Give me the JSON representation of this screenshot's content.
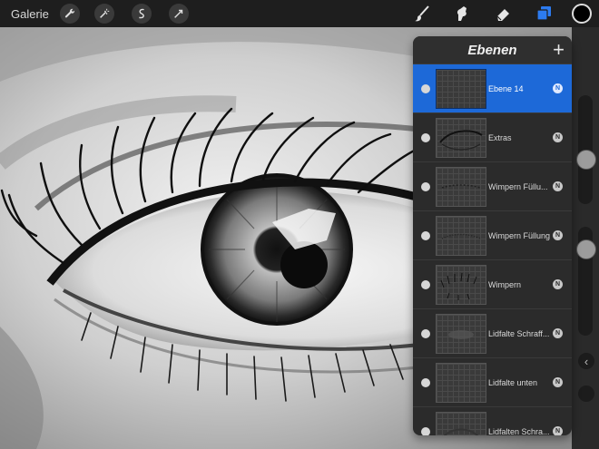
{
  "toolbar": {
    "gallery_label": "Galerie",
    "left_tools": [
      "wrench-icon",
      "magic-wand-icon",
      "selection-icon",
      "transform-icon"
    ],
    "right_tools": [
      "brush-icon",
      "smudge-icon",
      "eraser-icon",
      "layers-icon"
    ],
    "current_color": "#000000",
    "accent_color": "#1d69d8"
  },
  "layers_panel": {
    "title": "Ebenen",
    "add_label": "+",
    "layers": [
      {
        "name": "Ebene 14",
        "blend": "N",
        "active": true
      },
      {
        "name": "Extras",
        "blend": "N",
        "active": false
      },
      {
        "name": "Wimpern Füllu...",
        "blend": "N",
        "active": false
      },
      {
        "name": "Wimpern Füllung",
        "blend": "N",
        "active": false
      },
      {
        "name": "Wimpern",
        "blend": "N",
        "active": false
      },
      {
        "name": "Lidfalte Schraff...",
        "blend": "N",
        "active": false
      },
      {
        "name": "Lidfalte unten",
        "blend": "N",
        "active": false
      },
      {
        "name": "Lidfalten Schra...",
        "blend": "N",
        "active": false
      }
    ]
  },
  "sidebar": {
    "undo_label": "‹"
  }
}
